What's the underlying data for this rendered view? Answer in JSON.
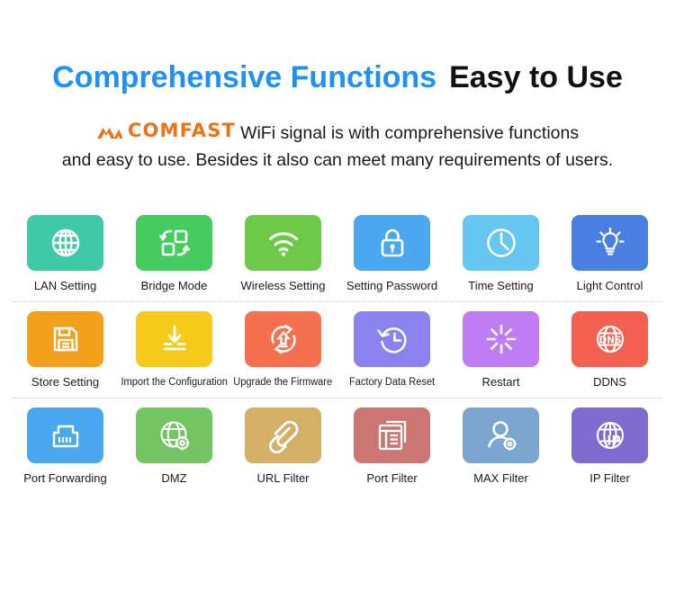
{
  "header": {
    "headline_accent": "Comprehensive Functions",
    "headline_plain": "Easy to Use",
    "accent_color": "#1e90f8",
    "brand": {
      "name": "COMFAST",
      "mark_icon": "comfast-mountain-logo-icon",
      "color": "#ef7215"
    },
    "body_line_1": "WiFi signal is with comprehensive functions",
    "body_line_2": "and easy to use. Besides it also can meet many requirements of users."
  },
  "grid": {
    "rows": [
      {
        "cells": [
          {
            "label": "LAN Setting",
            "icon": "globe-icon",
            "color": "#3fc9a6"
          },
          {
            "label": "Bridge Mode",
            "icon": "bridge-swap-icon",
            "color": "#45cc5f"
          },
          {
            "label": "Wireless Setting",
            "icon": "wifi-icon",
            "color": "#6ec94a"
          },
          {
            "label": "Setting Password",
            "icon": "lock-icon",
            "color": "#49a8ef"
          },
          {
            "label": "Time Setting",
            "icon": "clock-icon",
            "color": "#66c6f2"
          },
          {
            "label": "Light Control",
            "icon": "lightbulb-icon",
            "color": "#4a7ee0"
          }
        ]
      },
      {
        "cells": [
          {
            "label": "Store Setting",
            "icon": "floppy-save-icon",
            "color": "#f3a01c"
          },
          {
            "label": "Import the Configuration",
            "icon": "download-import-icon",
            "color": "#f5ca1b"
          },
          {
            "label": "Upgrade the Firmware",
            "icon": "upgrade-refresh-icon",
            "color": "#f4704f"
          },
          {
            "label": "Factory Data Reset",
            "icon": "clock-restore-icon",
            "color": "#8a82ef"
          },
          {
            "label": "Restart",
            "icon": "spinner-restart-icon",
            "color": "#c07cf5"
          },
          {
            "label": "DDNS",
            "icon": "dns-globe-icon",
            "color": "#f4604f"
          }
        ]
      },
      {
        "cells": [
          {
            "label": "Port Forwarding",
            "icon": "ethernet-port-icon",
            "color": "#49a8ef"
          },
          {
            "label": "DMZ",
            "icon": "globe-gear-icon",
            "color": "#74c464"
          },
          {
            "label": "URL Filter",
            "icon": "paperclip-link-icon",
            "color": "#d4b066"
          },
          {
            "label": "Port Filter",
            "icon": "document-list-icon",
            "color": "#cc7673"
          },
          {
            "label": "MAX Filter",
            "icon": "user-gear-icon",
            "color": "#7aa6cf"
          },
          {
            "label": "IP Filter",
            "icon": "ip-globe-icon",
            "color": "#7f6bd0"
          }
        ]
      }
    ]
  }
}
